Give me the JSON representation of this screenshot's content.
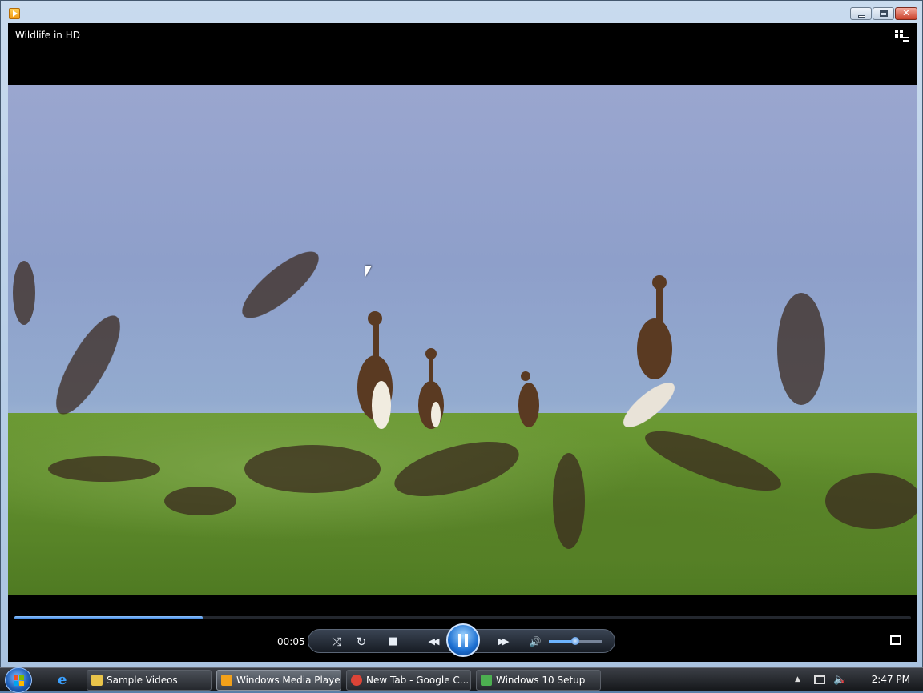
{
  "window": {
    "title": "Wildlife in HD",
    "controls": {
      "minimize_icon": "minimize-icon",
      "maximize_icon": "maximize-icon",
      "close_icon": "close-icon",
      "close_glyph": "✕"
    }
  },
  "player": {
    "now_playing": "Wildlife in HD",
    "elapsed": "00:05",
    "progress": 0.21,
    "volume": 0.5,
    "buttons": {
      "shuffle_icon": "⤨",
      "repeat_icon": "↻",
      "stop_icon": "■",
      "previous_icon": "◀◀",
      "pause_icon": "pause-icon",
      "next_icon": "▶▶",
      "mute_icon": "🔊"
    }
  },
  "taskbar": {
    "items": [
      {
        "label": "Sample Videos",
        "icon": "folder-icon",
        "color": "#e9c44a"
      },
      {
        "label": "Windows Media Player",
        "icon": "media-player-icon",
        "color": "#f2a11a",
        "active": true
      },
      {
        "label": "New Tab - Google C...",
        "icon": "chrome-icon",
        "color": "#db4437"
      },
      {
        "label": "Windows 10 Setup",
        "icon": "setup-icon",
        "color": "#4caf50"
      }
    ],
    "clock": "2:47 PM",
    "tray_arrow": "▲",
    "speaker_glyph": "🔈",
    "mute_glyph": "✕"
  },
  "colors": {
    "accent": "#2f7ad9",
    "window_frame": "#a9c3e0",
    "player_bg": "#000000"
  }
}
